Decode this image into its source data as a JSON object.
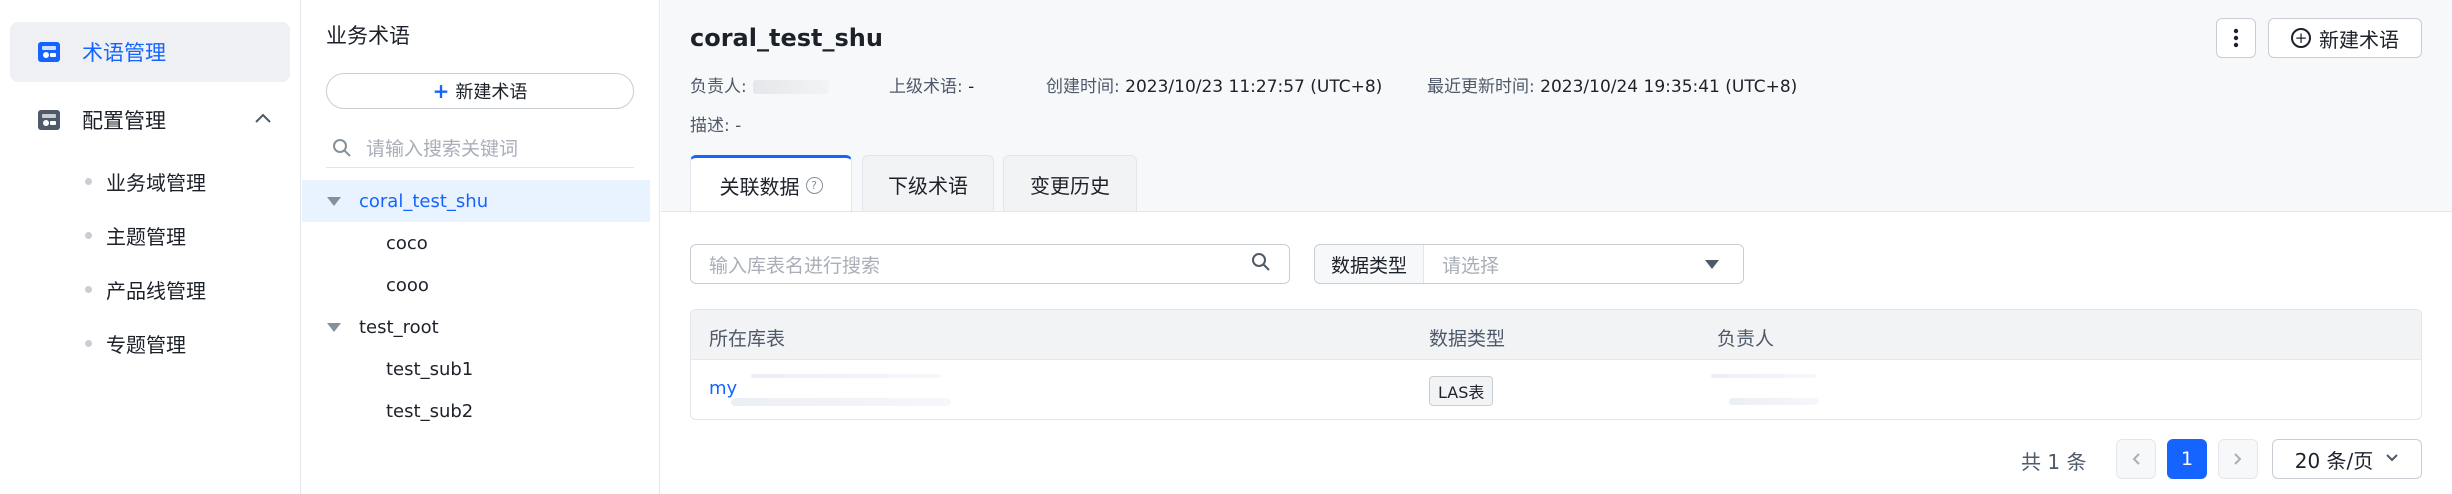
{
  "nav": {
    "items": [
      {
        "label": "术语管理",
        "icon": "glossary-icon"
      },
      {
        "label": "配置管理",
        "icon": "config-icon"
      }
    ],
    "config_subitems": [
      "业务域管理",
      "主题管理",
      "产品线管理",
      "专题管理"
    ]
  },
  "tree": {
    "title": "业务术语",
    "new_button": "新建术语",
    "search_placeholder": "请输入搜索关键词",
    "nodes": [
      {
        "label": "coral_test_shu",
        "level": 0,
        "expanded": true,
        "selected": true
      },
      {
        "label": "coco",
        "level": 1
      },
      {
        "label": "cooo",
        "level": 1
      },
      {
        "label": "test_root",
        "level": 0,
        "expanded": true
      },
      {
        "label": "test_sub1",
        "level": 1
      },
      {
        "label": "test_sub2",
        "level": 1
      }
    ]
  },
  "detail": {
    "title": "coral_test_shu",
    "new_term_button": "新建术语",
    "owner_label": "负责人:",
    "parent_label": "上级术语:",
    "parent_value": "-",
    "created_label": "创建时间:",
    "created_value": "2023/10/23 11:27:57 (UTC+8)",
    "updated_label": "最近更新时间:",
    "updated_value": "2023/10/24 19:35:41 (UTC+8)",
    "desc_label": "描述:",
    "desc_value": "-",
    "tabs": [
      "关联数据",
      "下级术语",
      "变更历史"
    ]
  },
  "filters": {
    "search_placeholder": "输入库表名进行搜索",
    "type_label": "数据类型",
    "type_placeholder": "请选择"
  },
  "table": {
    "columns": [
      "所在库表",
      "数据类型",
      "负责人"
    ],
    "rows": [
      {
        "table_prefix": "my",
        "type": "LAS表"
      }
    ]
  },
  "pagination": {
    "total": "共 1 条",
    "current": "1",
    "page_size": "20 条/页"
  },
  "colors": {
    "accent": "#1664ff",
    "nav_active_bg": "#eef0f4",
    "tree_selected_bg": "#e8f3ff"
  }
}
